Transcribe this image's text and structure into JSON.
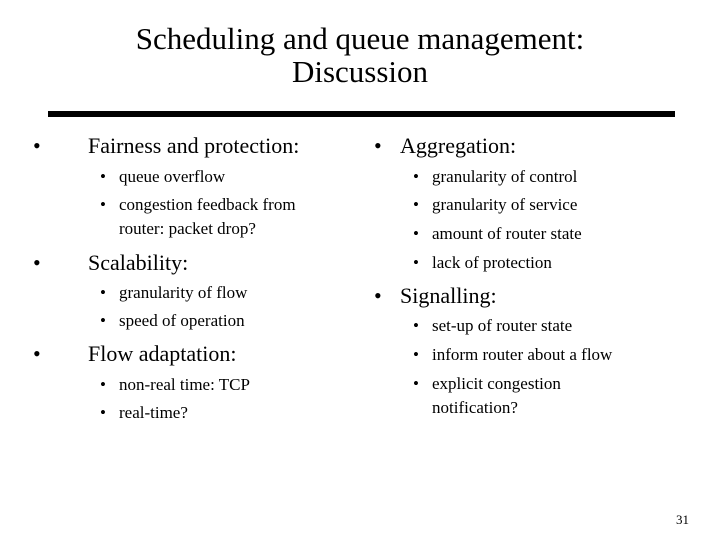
{
  "slide": {
    "title_line1": "Scheduling and queue management:",
    "title_line2": "Discussion",
    "page_number": "31",
    "bullet_glyph": "•"
  },
  "left_column": [
    {
      "heading": "Fairness and protection:",
      "items": [
        "queue overflow",
        "congestion feedback from",
        "router: packet drop?"
      ]
    },
    {
      "heading": "Scalability:",
      "items": [
        "granularity of flow",
        "speed of operation"
      ]
    },
    {
      "heading": "Flow adaptation:",
      "items": [
        "non-real time: TCP",
        "real-time?"
      ]
    }
  ],
  "right_column": [
    {
      "heading": "Aggregation:",
      "items": [
        "granularity of control",
        "granularity of service",
        "amount of router state",
        "lack of protection"
      ]
    },
    {
      "heading": "Signalling:",
      "items": [
        "set-up of router state",
        "inform router about a flow",
        "explicit congestion",
        "notification?"
      ]
    }
  ]
}
